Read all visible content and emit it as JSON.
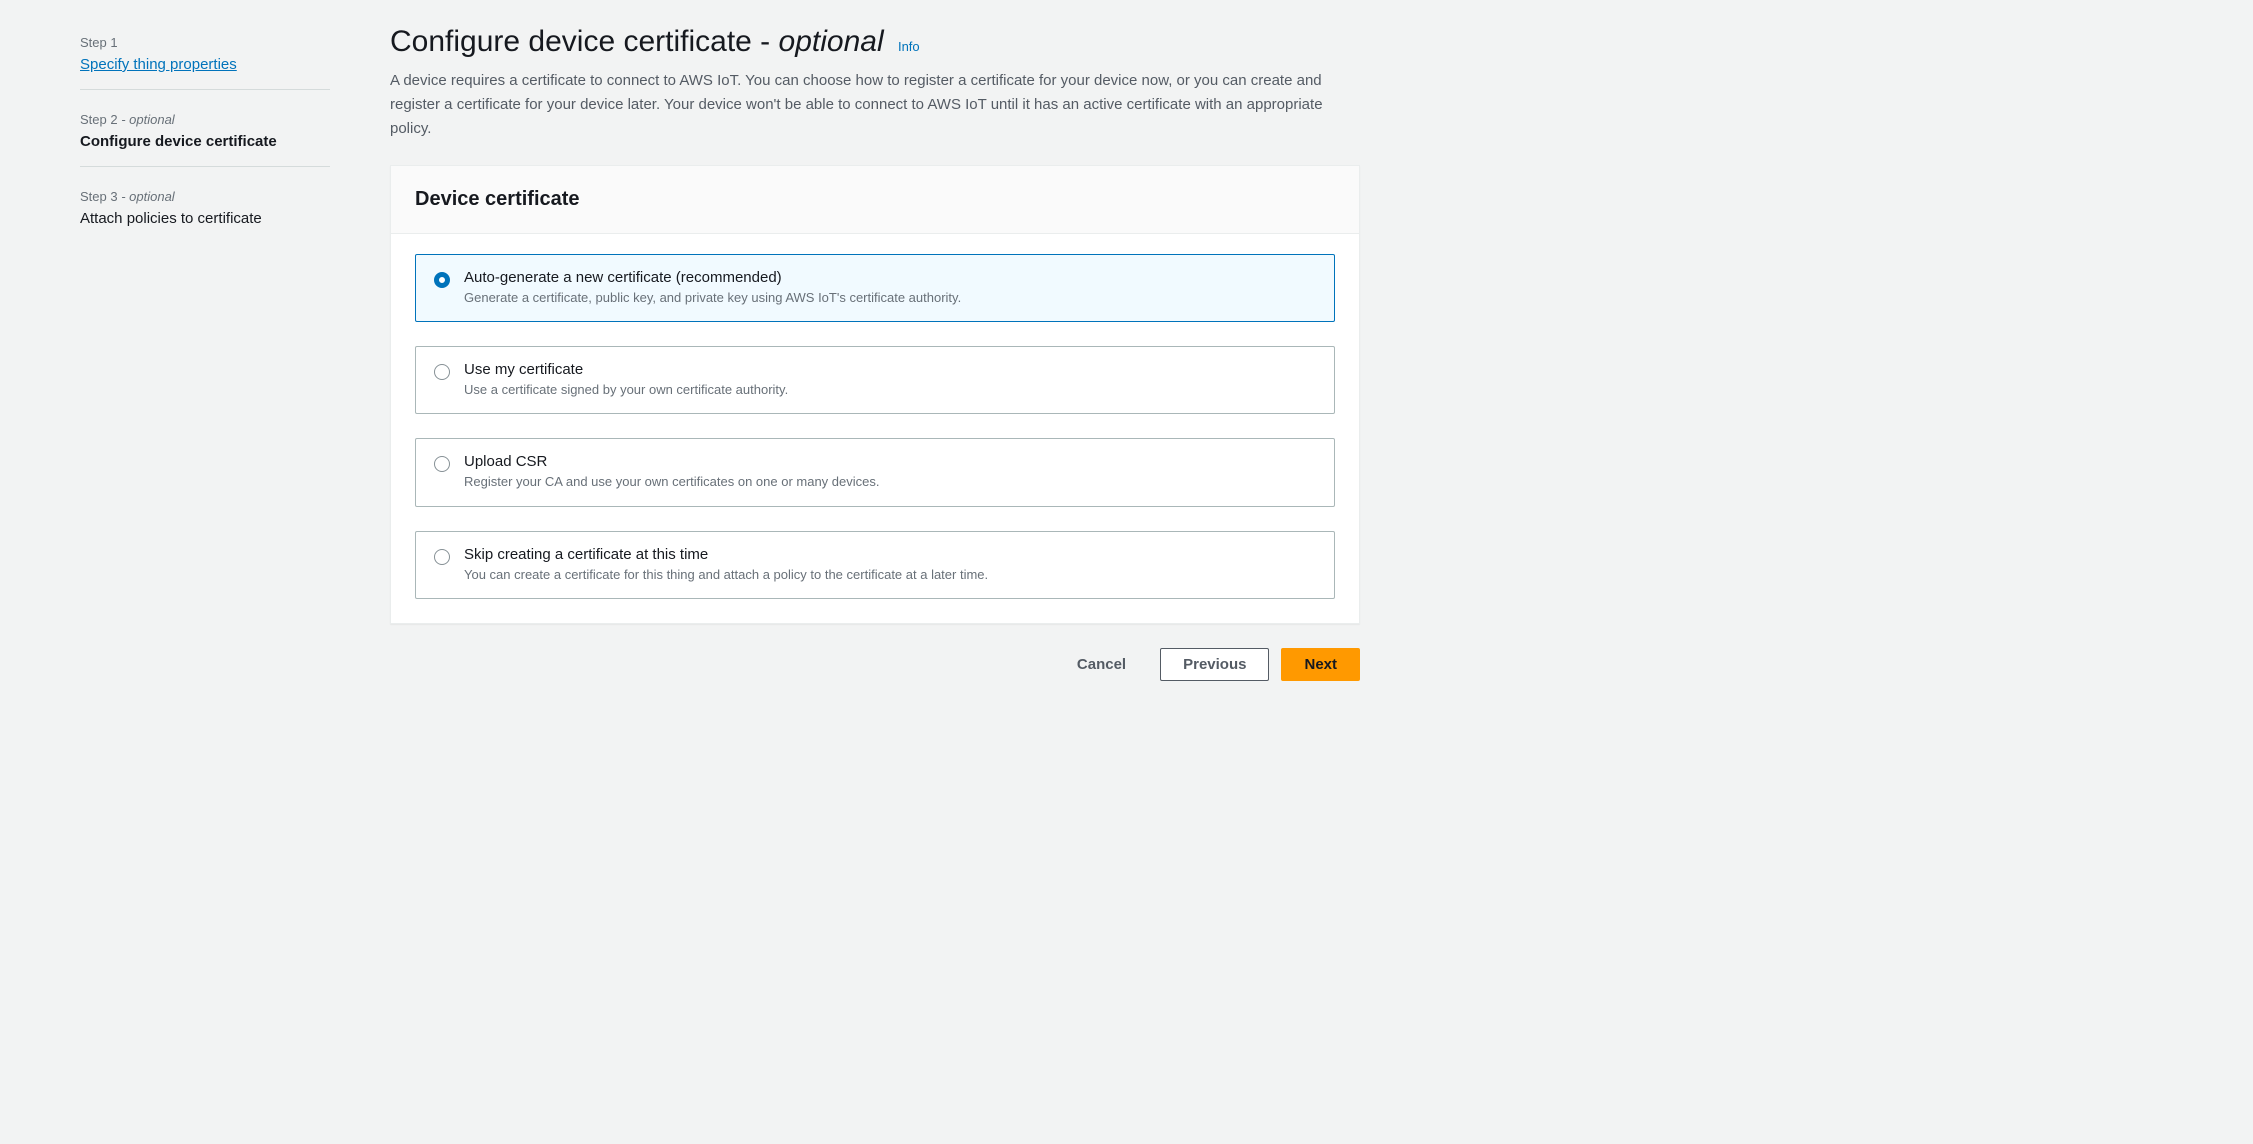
{
  "sidebar": {
    "steps": [
      {
        "label": "Step 1",
        "optional": "",
        "title": "Specify thing properties",
        "isLink": true,
        "isCurrent": false
      },
      {
        "label": "Step 2",
        "optional": " - optional",
        "title": "Configure device certificate",
        "isLink": false,
        "isCurrent": true
      },
      {
        "label": "Step 3",
        "optional": " - optional",
        "title": "Attach policies to certificate",
        "isLink": false,
        "isCurrent": false
      }
    ]
  },
  "header": {
    "title_prefix": "Configure device certificate - ",
    "title_optional": "optional",
    "info_label": "Info",
    "description": "A device requires a certificate to connect to AWS IoT. You can choose how to register a certificate for your device now, or you can create and register a certificate for your device later. Your device won't be able to connect to AWS IoT until it has an active certificate with an appropriate policy."
  },
  "panel": {
    "title": "Device certificate",
    "options": [
      {
        "title": "Auto-generate a new certificate (recommended)",
        "desc": "Generate a certificate, public key, and private key using AWS IoT's certificate authority.",
        "selected": true
      },
      {
        "title": "Use my certificate",
        "desc": "Use a certificate signed by your own certificate authority.",
        "selected": false
      },
      {
        "title": "Upload CSR",
        "desc": "Register your CA and use your own certificates on one or many devices.",
        "selected": false
      },
      {
        "title": "Skip creating a certificate at this time",
        "desc": "You can create a certificate for this thing and attach a policy to the certificate at a later time.",
        "selected": false
      }
    ]
  },
  "buttons": {
    "cancel": "Cancel",
    "previous": "Previous",
    "next": "Next"
  }
}
